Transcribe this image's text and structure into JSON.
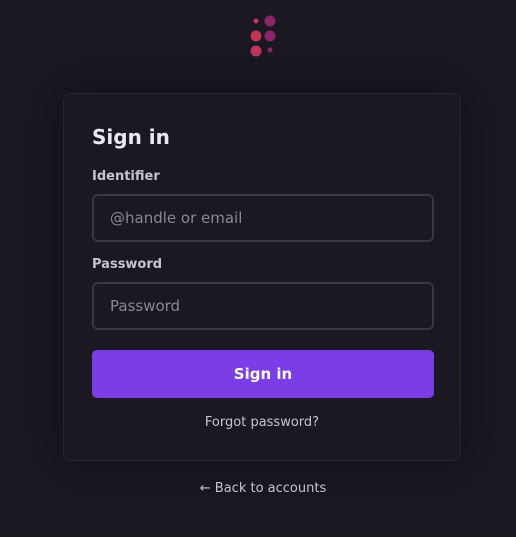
{
  "logo": {
    "icon": "dots-logo-icon",
    "colors": [
      "#c2365a",
      "#8a2567",
      "#a12860"
    ]
  },
  "card": {
    "title": "Sign in",
    "identifier": {
      "label": "Identifier",
      "value": "",
      "placeholder": "@handle or email"
    },
    "password": {
      "label": "Password",
      "value": "",
      "placeholder": "Password"
    },
    "submit_label": "Sign in",
    "forgot_label": "Forgot password?"
  },
  "footer": {
    "back_label": "← Back to accounts"
  },
  "colors": {
    "background": "#1b1822",
    "accent": "#7b3de6",
    "text": "#ece8f2",
    "muted": "#c8c2d2"
  }
}
